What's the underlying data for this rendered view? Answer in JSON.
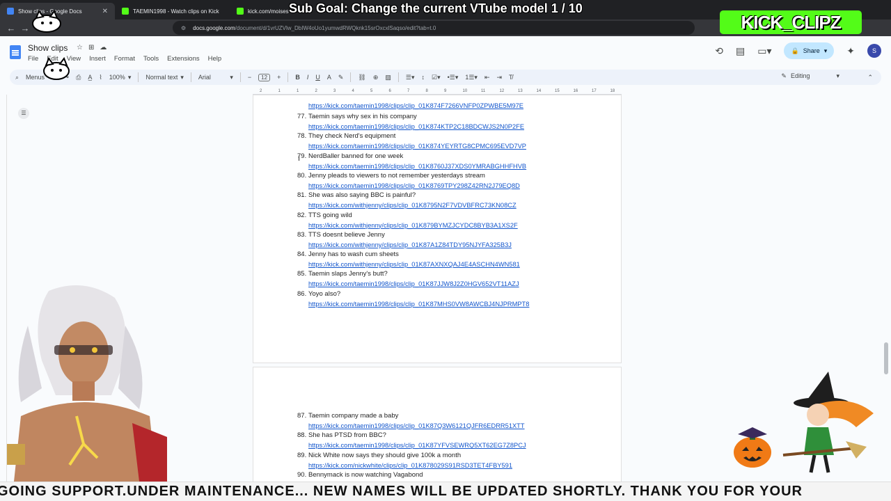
{
  "browser": {
    "tabs": [
      {
        "label": "Show clips - Google Docs",
        "active": true,
        "color": "#4285f4"
      },
      {
        "label": "TAEMIN1998 - Watch clips on Kick",
        "active": false,
        "color": "#53fc18"
      },
      {
        "label": "kick.com/moises",
        "active": false,
        "color": "#53fc18"
      }
    ],
    "url_domain": "docs.google.com",
    "url_path": "/document/d/1vrUZVlw_DbIW4oUo1yumwdRWQknk15srOxcxlSaqso/edit?tab=t.0"
  },
  "docs": {
    "title": "Show clips",
    "menus": [
      "File",
      "Edit",
      "View",
      "Insert",
      "Format",
      "Tools",
      "Extensions",
      "Help"
    ],
    "share_label": "Share",
    "avatar_letter": "S",
    "toolbar": {
      "search_label": "Menus",
      "zoom": "100%",
      "style": "Normal text",
      "font": "Arial",
      "size": "12",
      "mode": "Editing"
    },
    "ruler_ticks": [
      "2",
      "1",
      "1",
      "2",
      "3",
      "4",
      "5",
      "6",
      "7",
      "8",
      "9",
      "10",
      "11",
      "12",
      "13",
      "14",
      "15",
      "16",
      "17",
      "18"
    ]
  },
  "page1_entries": [
    {
      "num": "77.",
      "title": "Taemin says why sex in his company",
      "url": "https://kick.com/taemin1998/clips/clip_01K874KTP2C18BDCWJS2N0P2FE"
    },
    {
      "num": "78.",
      "title": "They check Nerd's equipment",
      "url": "https://kick.com/taemin1998/clips/clip_01K874YEYRTG8CPMC695EVD7VP"
    },
    {
      "num": "79.",
      "title": "NerdBaller banned for one week",
      "url": "https://kick.com/taemin1998/clips/clip_01K8760J37XDS0YMRABGHHFHVB"
    },
    {
      "num": "80.",
      "title": "Jenny pleads to viewers to not remember yesterdays stream",
      "url": "https://kick.com/taemin1998/clips/clip_01K8769TPY298Z42RN2J79EQ8D"
    },
    {
      "num": "81.",
      "title": "She was also saying BBC is painful?",
      "url": "https://kick.com/withjenny/clips/clip_01K8795N2F7VDVBFRC73KN08CZ"
    },
    {
      "num": "82.",
      "title": "TTS going wild",
      "url": "https://kick.com/withjenny/clips/clip_01K879BYMZJCYDC8BYB3A1XS2F"
    },
    {
      "num": "83.",
      "title": "TTS doesnt believe Jenny",
      "url": "https://kick.com/withjenny/clips/clip_01K87A1Z84TDY95NJYFA325B3J"
    },
    {
      "num": "84.",
      "title": "Jenny has to wash cum sheets",
      "url": "https://kick.com/withjenny/clips/clip_01K87AXNXQAJ4E4ASCHN4WN581"
    },
    {
      "num": "85.",
      "title": "Taemin slaps Jenny's butt?",
      "url": "https://kick.com/taemin1998/clips/clip_01K87JJW8J2Z0HGV652VT11AZJ"
    },
    {
      "num": "86.",
      "title": "Yoyo also?",
      "url": "https://kick.com/taemin1998/clips/clip_01K87MHS0VW8AWCBJ4NJPRMPT8"
    }
  ],
  "page1_top_url": "https://kick.com/taemin1998/clips/clip_01K874F7266VNFP0ZPWBE5M97E",
  "page2_entries": [
    {
      "num": "87.",
      "title": "Taemin company made a baby",
      "url": "https://kick.com/taemin1998/clips/clip_01K87Q3W6121QJFR6EDRR51XTT"
    },
    {
      "num": "88.",
      "title": "She has PTSD from BBC?",
      "url": "https://kick.com/taemin1998/clips/clip_01K87YFVSEWRQ5XT62EG7Z8PCJ"
    },
    {
      "num": "89.",
      "title": "Nick White now says they should give 100k a month",
      "url": "https://kick.com/nickwhite/clips/clip_01K878029S91RSD3TET4FBY591"
    },
    {
      "num": "90.",
      "title": "Bennymack is now watching Vagabond",
      "url": ""
    }
  ],
  "overlay": {
    "subgoal": "Sub Goal: Change the current VTube model  1 / 10",
    "kick_logo": "KICK_CLIPZ",
    "ticker": "GOING SUPPORT.UNDER MAINTENANCE... NEW NAMES WILL BE UPDATED SHORTLY. THANK YOU FOR YOUR"
  }
}
